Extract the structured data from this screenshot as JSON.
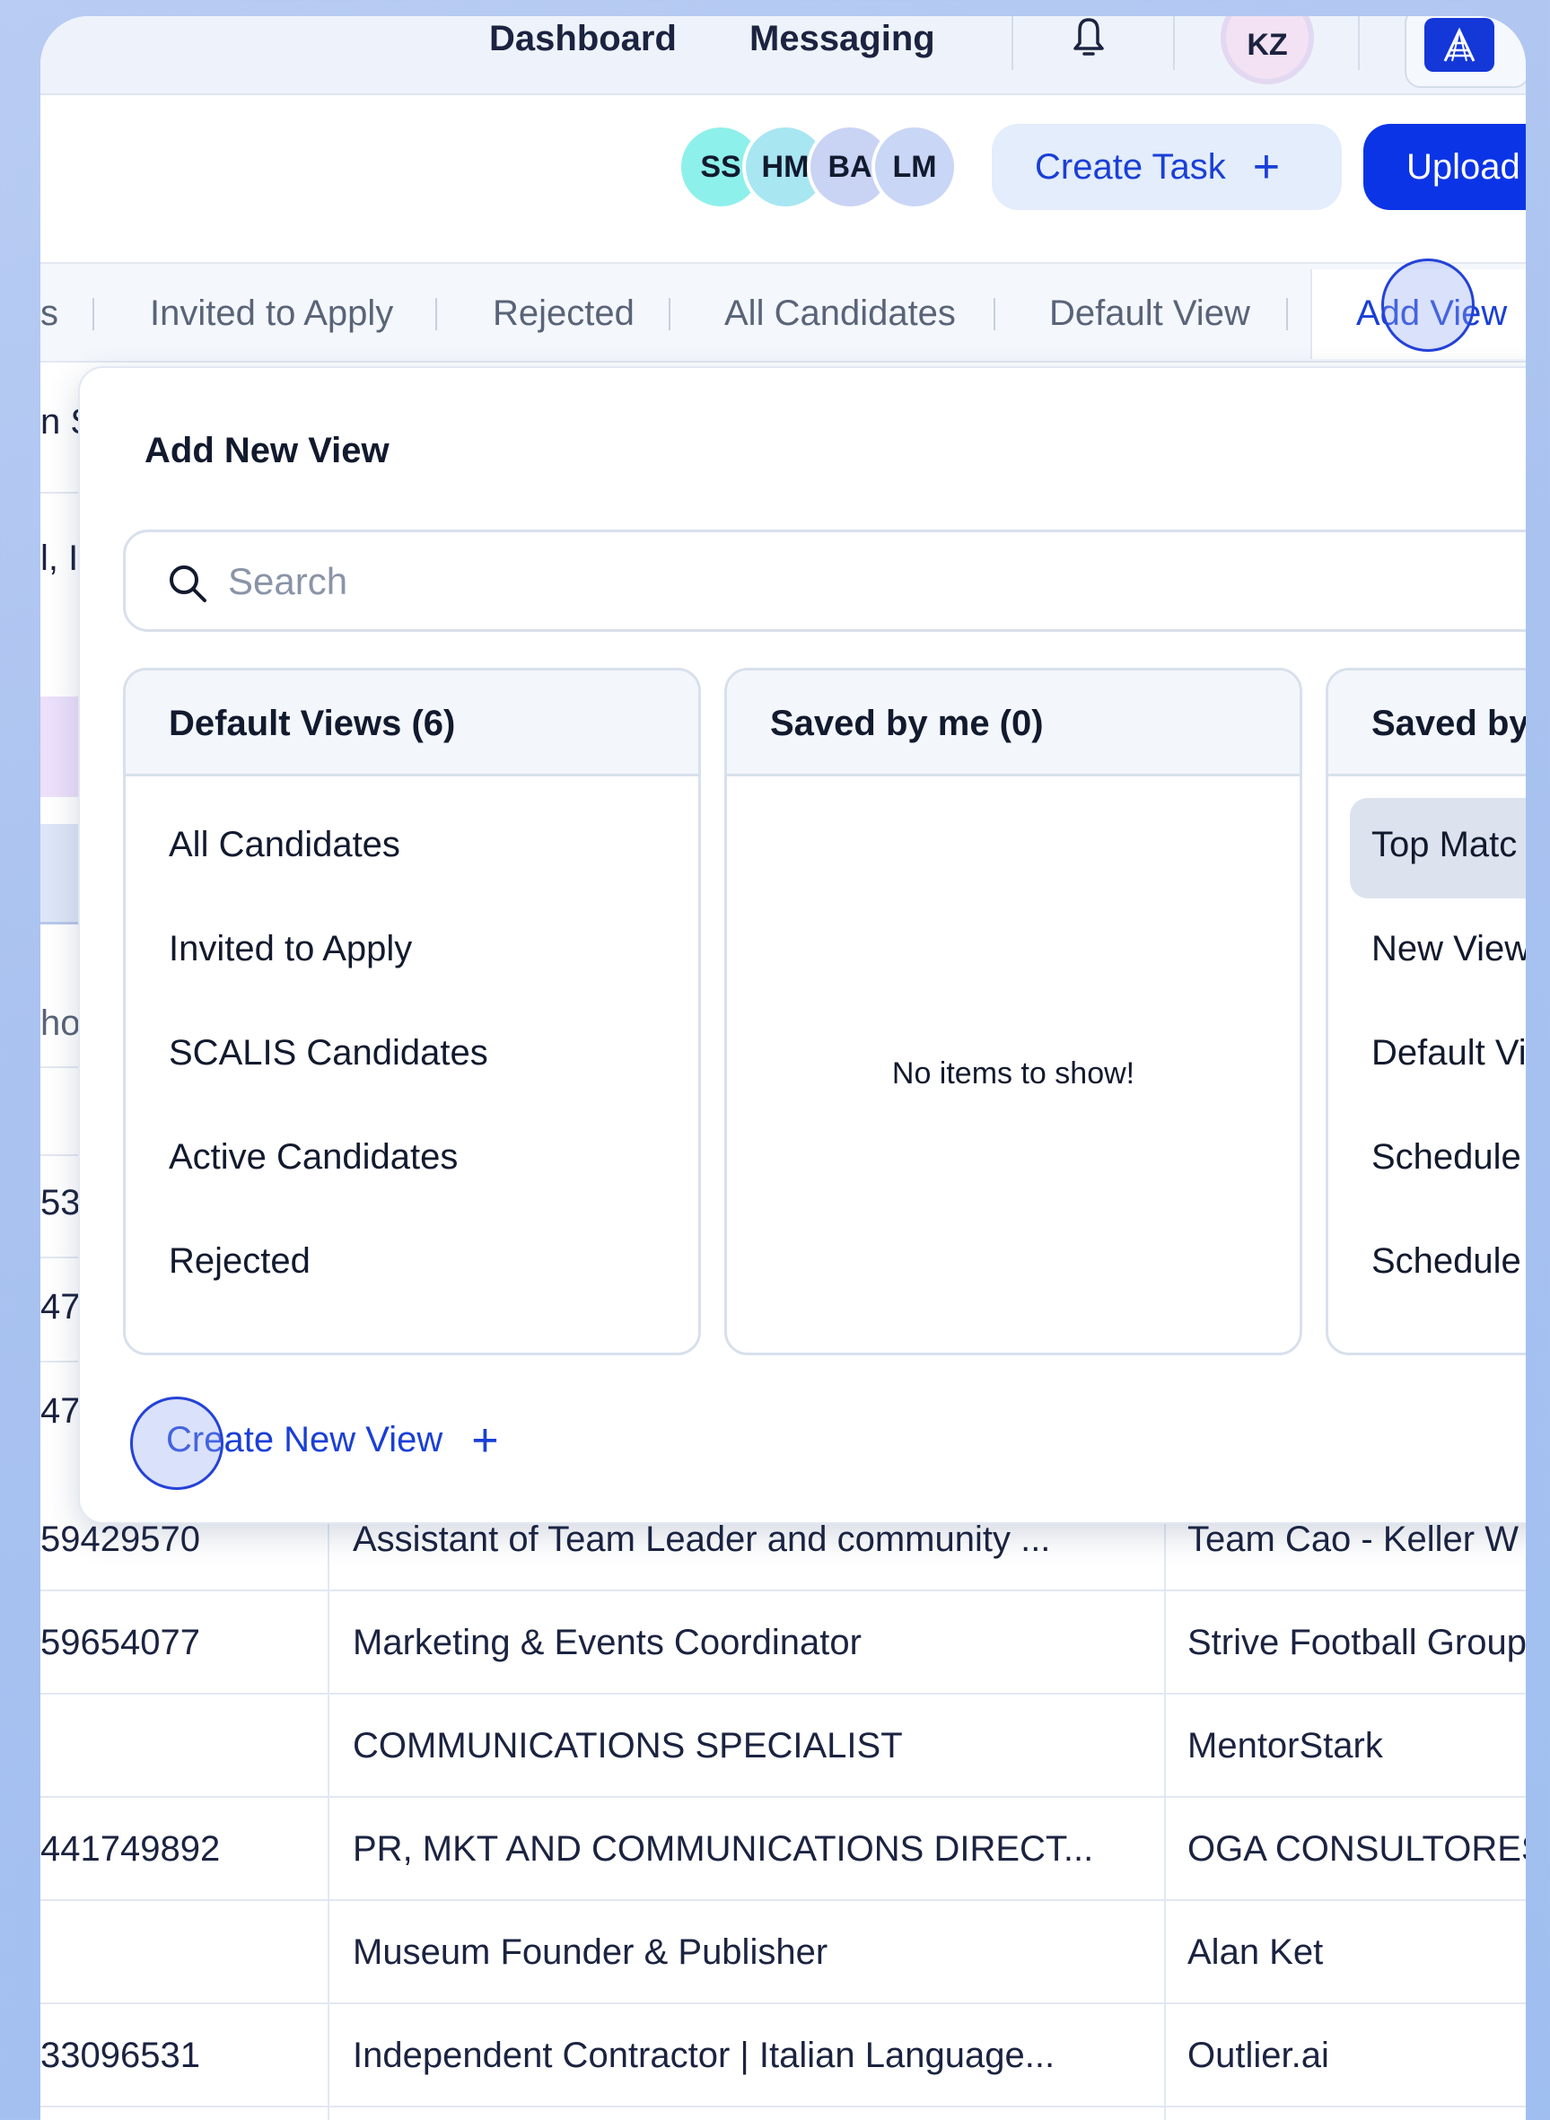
{
  "nav": {
    "dashboard": "Dashboard",
    "messaging": "Messaging",
    "notification_icon": "bell-icon",
    "user_initials": "KZ",
    "logo_icon": "company-logo-icon"
  },
  "actions": {
    "collaborators": [
      "SS",
      "HM",
      "BA",
      "LM"
    ],
    "create_task_label": "Create Task",
    "create_task_icon": "+",
    "upload_label": "Upload"
  },
  "tabs": {
    "items": [
      "s",
      "Invited to Apply",
      "Rejected",
      "All Candidates",
      "Default View"
    ],
    "add_view": "Add View"
  },
  "background_fragments": [
    "n S",
    "l, In",
    "ho",
    "53",
    "47",
    "47"
  ],
  "modal": {
    "title": "Add New View",
    "search_placeholder": "Search",
    "panels": {
      "default": {
        "header": "Default Views (6)",
        "items": [
          "All Candidates",
          "Invited to Apply",
          "SCALIS Candidates",
          "Active Candidates",
          "Rejected"
        ]
      },
      "saved_by_me": {
        "header": "Saved by me (0)",
        "empty_text": "No items to show!"
      },
      "saved_by_others": {
        "header": "Saved by",
        "items": [
          "Top Matc",
          "New View",
          "Default Vi",
          "Schedule",
          "Schedule"
        ]
      }
    },
    "create_new_view": "Create New View",
    "create_new_view_icon": "+"
  },
  "table": {
    "rows": [
      {
        "phone": "59429570",
        "title": "Assistant of Team Leader and community ...",
        "company": "Team Cao - Keller W"
      },
      {
        "phone": "59654077",
        "title": "Marketing & Events Coordinator",
        "company": "Strive Football Group"
      },
      {
        "phone": "",
        "title": "COMMUNICATIONS SPECIALIST",
        "company": "MentorStark"
      },
      {
        "phone": "441749892",
        "title": "PR, MKT AND COMMUNICATIONS DIRECT...",
        "company": "OGA CONSULTORES"
      },
      {
        "phone": "",
        "title": "Museum Founder & Publisher",
        "company": "Alan Ket"
      },
      {
        "phone": "33096531",
        "title": "Independent Contractor | Italian Language...",
        "company": "Outlier.ai"
      }
    ]
  },
  "colors": {
    "accent": "#1a3fd6",
    "primary_button": "#0b34e6",
    "avatar_ss": "#8ef0ea",
    "avatar_hm": "#a8e6f2",
    "avatar_ba": "#c9d3f4",
    "avatar_lm": "#c9d6f6"
  }
}
